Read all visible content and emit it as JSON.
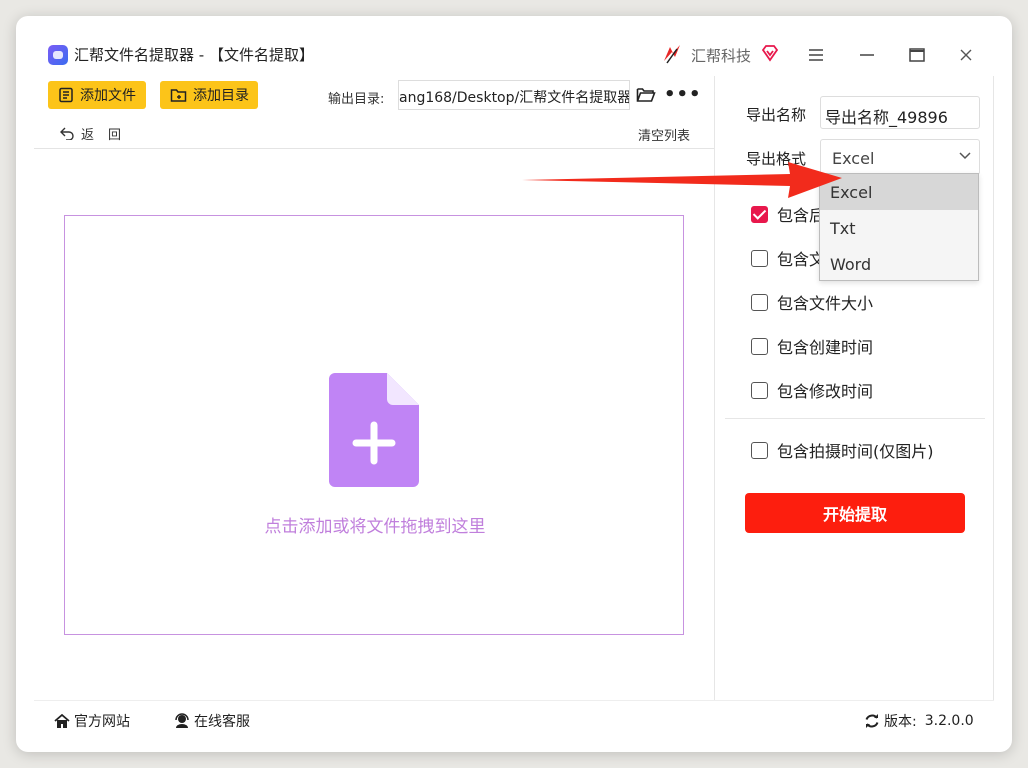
{
  "window": {
    "title": "汇帮文件名提取器 - 【文件名提取】",
    "brand": "汇帮科技"
  },
  "toolbar": {
    "add_file": "添加文件",
    "add_folder": "添加目录",
    "output_dir_label": "输出目录:",
    "output_dir_value": "ang168/Desktop/汇帮文件名提取器",
    "more": "•••",
    "back": "返回",
    "clear_list": "清空列表"
  },
  "drop_zone": {
    "text": "点击添加或将文件拖拽到这里"
  },
  "right": {
    "export_name_label": "导出名称",
    "export_name_value": "导出名称_49896",
    "export_format_label": "导出格式",
    "export_format_value": "Excel",
    "options": [
      {
        "label": "包含后",
        "checked": true
      },
      {
        "label": "包含文",
        "checked": false
      },
      {
        "label": "包含文件大小",
        "checked": false
      },
      {
        "label": "包含创建时间",
        "checked": false
      },
      {
        "label": "包含修改时间",
        "checked": false
      }
    ],
    "photo_option": {
      "label": "包含拍摄时间(仅图片)",
      "checked": false
    },
    "start": "开始提取"
  },
  "dropdown": {
    "options": [
      "Excel",
      "Txt",
      "Word"
    ],
    "selected": "Excel"
  },
  "bottom": {
    "site": "官方网站",
    "support": "在线客服",
    "version_label": "版本:",
    "version_value": "3.2.0.0"
  },
  "colors": {
    "accent_yellow": "#fcc419",
    "start_red": "#fd1e0e",
    "check_pink": "#e8184c",
    "drop_purple": "#c07fdc",
    "arrow_red": "#f22b1c"
  }
}
